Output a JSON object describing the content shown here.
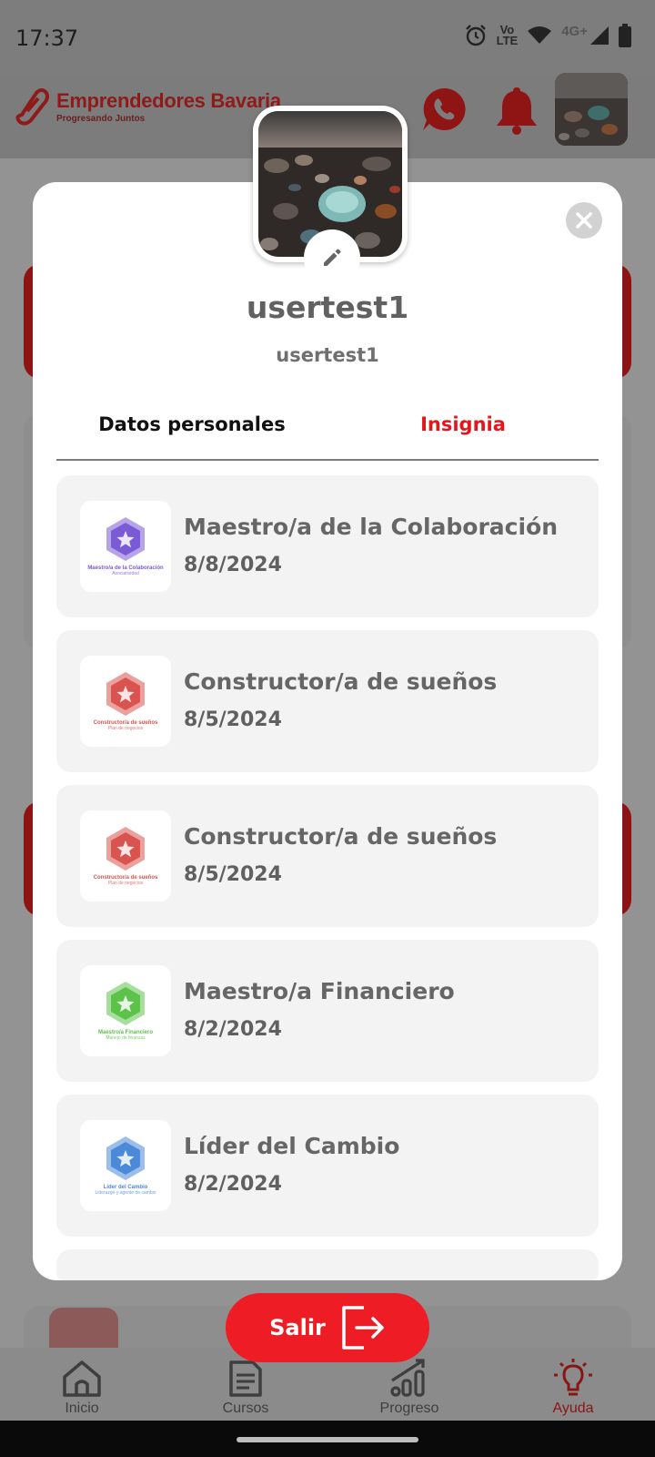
{
  "status_bar": {
    "time": "17:37",
    "network_vo": "Vo",
    "network_lte": "LTE",
    "network_4g": "4G+",
    "icons": [
      "alarm-icon",
      "wifi-icon",
      "signal-icon",
      "battery-icon"
    ]
  },
  "header": {
    "brand": "Emprendedores Bavaria",
    "tagline": "Progresando Juntos",
    "icons": [
      "whatsapp-icon",
      "bell-icon",
      "avatar"
    ]
  },
  "profile": {
    "username": "usertest1",
    "handle": "usertest1"
  },
  "tabs": [
    {
      "label": "Datos personales",
      "active": false
    },
    {
      "label": "Insignia",
      "active": true
    }
  ],
  "badges": [
    {
      "title": "Maestro/a de la Colaboración",
      "date": "8/8/2024",
      "caption": "Maestro/a de la Colaboración",
      "subcaption": "Asociatividad",
      "color": "#7b5ad6"
    },
    {
      "title": "Constructor/a de sueños",
      "date": "8/5/2024",
      "caption": "Constructor/a de sueños",
      "subcaption": "Plan de negocios",
      "color": "#d9534f"
    },
    {
      "title": "Constructor/a de sueños",
      "date": "8/5/2024",
      "caption": "Constructor/a de sueños",
      "subcaption": "Plan de negocios",
      "color": "#d9534f"
    },
    {
      "title": "Maestro/a Financiero",
      "date": "8/2/2024",
      "caption": "Maestro/a Financiero",
      "subcaption": "Manejo de finanzas",
      "color": "#5cc24a"
    },
    {
      "title": "Líder del Cambio",
      "date": "8/2/2024",
      "caption": "Líder del Cambio",
      "subcaption": "Liderazgo y agente de cambio",
      "color": "#4a8ad8"
    }
  ],
  "exit_button": {
    "label": "Salir"
  },
  "bottom_nav": [
    {
      "label": "Inicio",
      "icon": "home-icon",
      "active": false
    },
    {
      "label": "Cursos",
      "icon": "document-icon",
      "active": false
    },
    {
      "label": "Progreso",
      "icon": "chart-icon",
      "active": false
    },
    {
      "label": "Ayuda",
      "icon": "lightbulb-icon",
      "active": true
    }
  ],
  "colors": {
    "accent": "#ee1c24",
    "active_tab": "#e8141c",
    "card_bg": "#f3f3f3",
    "text_gray": "#666666"
  }
}
